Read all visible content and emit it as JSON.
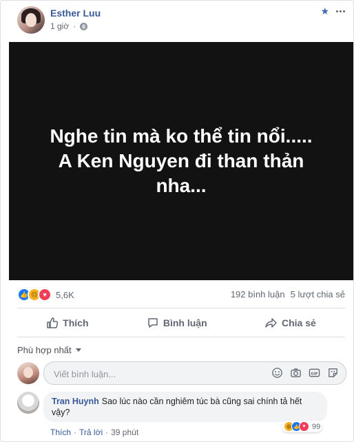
{
  "post": {
    "author": "Esther Luu",
    "time": "1 giờ",
    "image_lines": [
      "Nghe tin mà ko thể tin nổi.....",
      "A Ken Nguyen đi than thản",
      "nha..."
    ]
  },
  "reactions": {
    "count": "5,6K",
    "comments": "192 bình luận",
    "shares": "5 lượt chia sẻ"
  },
  "actions": {
    "like": "Thích",
    "comment": "Bình luận",
    "share": "Chia sẻ"
  },
  "filter": {
    "label": "Phù hợp nhất"
  },
  "composer": {
    "placeholder": "Viết bình luận..."
  },
  "comment": {
    "author": "Tran Huynh",
    "text": "Sao lúc nào cần nghiêm túc bà cũng sai chính tả hết vậy?",
    "reaction_count": "99",
    "like": "Thích",
    "reply": "Trả lời",
    "time": "39 phút"
  },
  "colors": {
    "link_blue": "#385898",
    "like_blue": "#1877f2",
    "image_bg": "#121212"
  }
}
